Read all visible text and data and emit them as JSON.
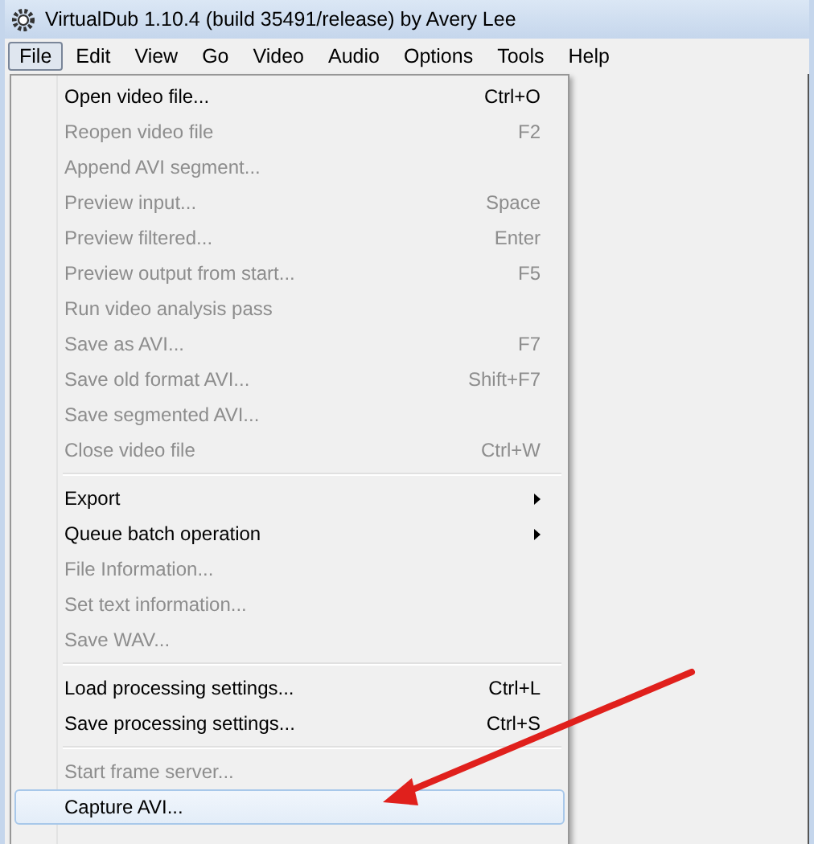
{
  "window": {
    "title": "VirtualDub 1.10.4 (build 35491/release) by Avery Lee"
  },
  "menubar": [
    {
      "label": "File",
      "selected": true
    },
    {
      "label": "Edit",
      "selected": false
    },
    {
      "label": "View",
      "selected": false
    },
    {
      "label": "Go",
      "selected": false
    },
    {
      "label": "Video",
      "selected": false
    },
    {
      "label": "Audio",
      "selected": false
    },
    {
      "label": "Options",
      "selected": false
    },
    {
      "label": "Tools",
      "selected": false
    },
    {
      "label": "Help",
      "selected": false
    }
  ],
  "menu": {
    "groups": [
      [
        {
          "label": "Open video file...",
          "shortcut": "Ctrl+O",
          "disabled": false,
          "submenu": false,
          "selected": false
        },
        {
          "label": "Reopen video file",
          "shortcut": "F2",
          "disabled": true,
          "submenu": false,
          "selected": false
        },
        {
          "label": "Append AVI segment...",
          "disabled": true,
          "submenu": false,
          "selected": false
        },
        {
          "label": "Preview input...",
          "shortcut": "Space",
          "disabled": true,
          "submenu": false,
          "selected": false
        },
        {
          "label": "Preview filtered...",
          "shortcut": "Enter",
          "disabled": true,
          "submenu": false,
          "selected": false
        },
        {
          "label": "Preview output from start...",
          "shortcut": "F5",
          "disabled": true,
          "submenu": false,
          "selected": false
        },
        {
          "label": "Run video analysis pass",
          "disabled": true,
          "submenu": false,
          "selected": false
        },
        {
          "label": "Save as AVI...",
          "shortcut": "F7",
          "disabled": true,
          "submenu": false,
          "selected": false
        },
        {
          "label": "Save old format AVI...",
          "shortcut": "Shift+F7",
          "disabled": true,
          "submenu": false,
          "selected": false
        },
        {
          "label": "Save segmented AVI...",
          "disabled": true,
          "submenu": false,
          "selected": false
        },
        {
          "label": "Close video file",
          "shortcut": "Ctrl+W",
          "disabled": true,
          "submenu": false,
          "selected": false
        }
      ],
      [
        {
          "label": "Export",
          "disabled": false,
          "submenu": true,
          "selected": false
        },
        {
          "label": "Queue batch operation",
          "disabled": false,
          "submenu": true,
          "selected": false
        },
        {
          "label": "File Information...",
          "disabled": true,
          "submenu": false,
          "selected": false
        },
        {
          "label": "Set text information...",
          "disabled": true,
          "submenu": false,
          "selected": false
        },
        {
          "label": "Save WAV...",
          "disabled": true,
          "submenu": false,
          "selected": false
        }
      ],
      [
        {
          "label": "Load processing settings...",
          "shortcut": "Ctrl+L",
          "disabled": false,
          "submenu": false,
          "selected": false
        },
        {
          "label": "Save processing settings...",
          "shortcut": "Ctrl+S",
          "disabled": false,
          "submenu": false,
          "selected": false
        }
      ],
      [
        {
          "label": "Start frame server...",
          "disabled": true,
          "submenu": false,
          "selected": false
        },
        {
          "label": "Capture AVI...",
          "disabled": false,
          "submenu": false,
          "selected": true
        }
      ]
    ]
  }
}
